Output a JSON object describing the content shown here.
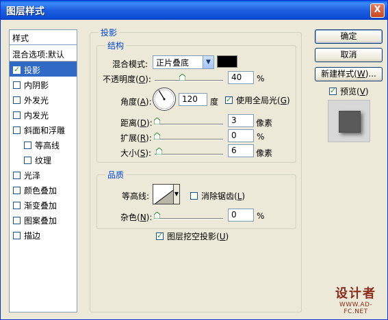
{
  "window": {
    "title": "图层样式",
    "close": "X"
  },
  "list": {
    "header": "样式",
    "blend": "混合选项:默认",
    "items": [
      {
        "label": "投影",
        "checked": true,
        "selected": true,
        "indent": false
      },
      {
        "label": "内阴影",
        "checked": false,
        "selected": false,
        "indent": false
      },
      {
        "label": "外发光",
        "checked": false,
        "selected": false,
        "indent": false
      },
      {
        "label": "内发光",
        "checked": false,
        "selected": false,
        "indent": false
      },
      {
        "label": "斜面和浮雕",
        "checked": false,
        "selected": false,
        "indent": false
      },
      {
        "label": "等高线",
        "checked": false,
        "selected": false,
        "indent": true
      },
      {
        "label": "纹理",
        "checked": false,
        "selected": false,
        "indent": true
      },
      {
        "label": "光泽",
        "checked": false,
        "selected": false,
        "indent": false
      },
      {
        "label": "颜色叠加",
        "checked": false,
        "selected": false,
        "indent": false
      },
      {
        "label": "渐变叠加",
        "checked": false,
        "selected": false,
        "indent": false
      },
      {
        "label": "图案叠加",
        "checked": false,
        "selected": false,
        "indent": false
      },
      {
        "label": "描边",
        "checked": false,
        "selected": false,
        "indent": false
      }
    ]
  },
  "shadow": {
    "title": "投影",
    "structure_title": "结构",
    "blend_mode_label": "混合模式:",
    "blend_mode_value": "正片叠底",
    "shadow_color": "#000000",
    "opacity_label_pre": "不透明度(",
    "opacity_key": "O",
    "opacity_label_post": "):",
    "opacity_value": "40",
    "percent": "%",
    "angle_label_pre": "角度(",
    "angle_key": "A",
    "angle_label_post": "):",
    "angle_value": "120",
    "degree_unit": "度",
    "global_light_pre": "使用全局光(",
    "global_light_key": "G",
    "global_light_post": ")",
    "distance_label_pre": "距离(",
    "distance_key": "D",
    "distance_label_post": "):",
    "distance_value": "3",
    "pixel_unit": "像素",
    "spread_label_pre": "扩展(",
    "spread_key": "R",
    "spread_label_post": "):",
    "spread_value": "0",
    "size_label_pre": "大小(",
    "size_key": "S",
    "size_label_post": "):",
    "size_value": "6",
    "quality_title": "品质",
    "contour_label": "等高线:",
    "antialias_pre": "消除锯齿(",
    "antialias_key": "L",
    "antialias_post": ")",
    "noise_label_pre": "杂色(",
    "noise_key": "N",
    "noise_label_post": "):",
    "noise_value": "0",
    "knockout_pre": "图层挖空投影(",
    "knockout_key": "U",
    "knockout_post": ")"
  },
  "buttons": {
    "ok": "确定",
    "cancel": "取消",
    "new_style_pre": "新建样式(",
    "new_style_key": "W",
    "new_style_post": ")...",
    "preview_pre": "预览(",
    "preview_key": "V",
    "preview_post": ")"
  },
  "watermark": {
    "big": "设计者",
    "small": "WWW.AD-FC.NET"
  }
}
